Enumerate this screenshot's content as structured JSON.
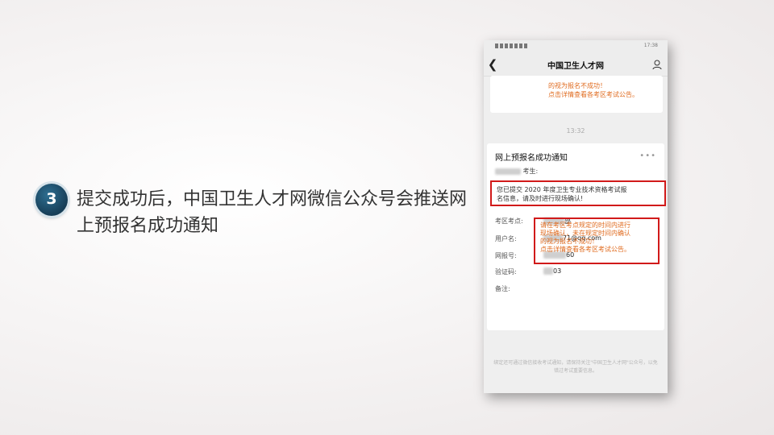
{
  "step": {
    "number": "3",
    "caption": "提交成功后，中国卫生人才网微信公众号会推送网上预报名成功通知"
  },
  "phone": {
    "status_time": "17:38",
    "nav": {
      "title": "中国卫生人才网"
    },
    "prev_card": {
      "lines": [
        "的视为报名不成功！",
        "点击详情查看各考区考试公告。"
      ]
    },
    "timestamp": "13:32",
    "card": {
      "title": "网上预报名成功通知",
      "greeting_suffix": "考生:",
      "notice": [
        "您已提交 2020 年度卫生专业技术资格考试报",
        "名信息，请及时进行现场确认!"
      ],
      "rows": [
        {
          "label": "考区考点:",
          "value": "部"
        },
        {
          "label": "用户名:",
          "value": "71@qq.com"
        },
        {
          "label": "网报号:",
          "value": "60"
        },
        {
          "label": "验证码:",
          "value": "03"
        },
        {
          "label": "备注:",
          "value": ""
        }
      ],
      "remark": [
        "请在考区考点规定的时间内进行",
        "现场确认，未在规定时间内确认",
        "的视为报名不成功！",
        "点击详情查看各考区考试公告。"
      ]
    },
    "footer": "绑定还可通过微信接收考试通知，请保持关注\"中国卫生人才网\"公众号，以免错过考试重要信息。"
  }
}
